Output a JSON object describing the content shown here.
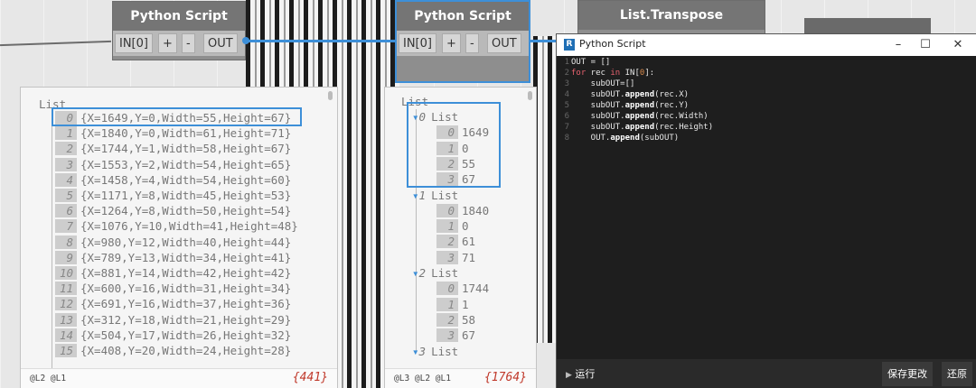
{
  "nodes": {
    "python_left": {
      "title": "Python Script",
      "in_port": "IN[0]",
      "add": "+",
      "remove": "-",
      "out_port": "OUT"
    },
    "python_mid": {
      "title": "Python Script",
      "in_port": "IN[0]",
      "add": "+",
      "remove": "-",
      "out_port": "OUT"
    },
    "transpose": {
      "title": "List.Transpose"
    }
  },
  "preview_left": {
    "header": "List",
    "rows": [
      {
        "i": "0",
        "v": "{X=1649,Y=0,Width=55,Height=67}"
      },
      {
        "i": "1",
        "v": "{X=1840,Y=0,Width=61,Height=71}"
      },
      {
        "i": "2",
        "v": "{X=1744,Y=1,Width=58,Height=67}"
      },
      {
        "i": "3",
        "v": "{X=1553,Y=2,Width=54,Height=65}"
      },
      {
        "i": "4",
        "v": "{X=1458,Y=4,Width=54,Height=60}"
      },
      {
        "i": "5",
        "v": "{X=1171,Y=8,Width=45,Height=53}"
      },
      {
        "i": "6",
        "v": "{X=1264,Y=8,Width=50,Height=54}"
      },
      {
        "i": "7",
        "v": "{X=1076,Y=10,Width=41,Height=48}"
      },
      {
        "i": "8",
        "v": "{X=980,Y=12,Width=40,Height=44}"
      },
      {
        "i": "9",
        "v": "{X=789,Y=13,Width=34,Height=41}"
      },
      {
        "i": "10",
        "v": "{X=881,Y=14,Width=42,Height=42}"
      },
      {
        "i": "11",
        "v": "{X=600,Y=16,Width=31,Height=34}"
      },
      {
        "i": "12",
        "v": "{X=691,Y=16,Width=37,Height=36}"
      },
      {
        "i": "13",
        "v": "{X=312,Y=18,Width=21,Height=29}"
      },
      {
        "i": "14",
        "v": "{X=504,Y=17,Width=26,Height=32}"
      },
      {
        "i": "15",
        "v": "{X=408,Y=20,Width=24,Height=28}"
      }
    ],
    "levels": "@L2 @L1",
    "count": "{441}"
  },
  "preview_mid": {
    "header": "List",
    "groups": [
      {
        "i": "0",
        "label": "List",
        "items": [
          {
            "i": "0",
            "v": "1649"
          },
          {
            "i": "1",
            "v": "0"
          },
          {
            "i": "2",
            "v": "55"
          },
          {
            "i": "3",
            "v": "67"
          }
        ]
      },
      {
        "i": "1",
        "label": "List",
        "items": [
          {
            "i": "0",
            "v": "1840"
          },
          {
            "i": "1",
            "v": "0"
          },
          {
            "i": "2",
            "v": "61"
          },
          {
            "i": "3",
            "v": "71"
          }
        ]
      },
      {
        "i": "2",
        "label": "List",
        "items": [
          {
            "i": "0",
            "v": "1744"
          },
          {
            "i": "1",
            "v": "1"
          },
          {
            "i": "2",
            "v": "58"
          },
          {
            "i": "3",
            "v": "67"
          }
        ]
      },
      {
        "i": "3",
        "label": "List",
        "items": []
      }
    ],
    "levels": "@L3 @L2 @L1",
    "count": "{1764}"
  },
  "editor": {
    "title": "Python Script",
    "minimize": "–",
    "maximize": "☐",
    "close": "✕",
    "run_icon": "▶",
    "run_label": "运行",
    "save_label": "保存更改",
    "revert_label": "还原"
  },
  "colors": {
    "accent": "#3d8fd8",
    "node_title": "#757575",
    "editor_bg": "#1e1e1e",
    "count": "#c0392b"
  },
  "icons": [
    "python-script-icon",
    "run-icon",
    "expand-arrow-icon"
  ]
}
